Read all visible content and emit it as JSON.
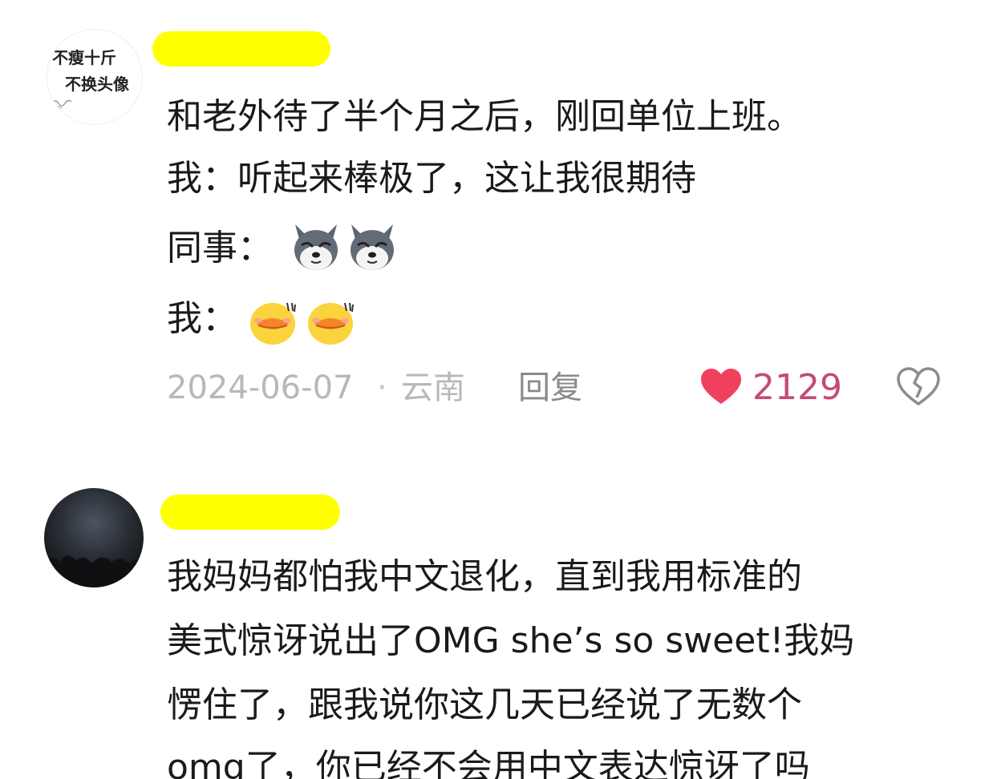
{
  "comments": [
    {
      "avatar_text": [
        "不瘦十斤",
        "不换头像"
      ],
      "lines": [
        "和老外待了半个月之后，刚回单位上班。",
        "我：听起来棒极了，这让我很期待",
        "同事：",
        "我："
      ],
      "emojis": {
        "line3": [
          "husky-dog-emoji",
          "husky-dog-emoji"
        ],
        "line4": [
          "shy-duck-emoji",
          "shy-duck-emoji"
        ]
      },
      "date": "2024-06-07",
      "separator": "·",
      "location": "云南",
      "reply_label": "回复",
      "like_count": "2129",
      "like_icon": "heart-icon",
      "dislike_icon": "broken-heart-icon",
      "like_color": "#f0405e",
      "like_count_color": "#c44b72"
    },
    {
      "lines": [
        "我妈妈都怕我中文退化，直到我用标准的",
        "美式惊讶说出了OMG she’s so sweet!我妈",
        "愣住了，跟我说你这几天已经说了无数个",
        "omg了，你已经不会用中文表达惊讶了吗"
      ]
    }
  ],
  "highlight_color": "#ffff00"
}
